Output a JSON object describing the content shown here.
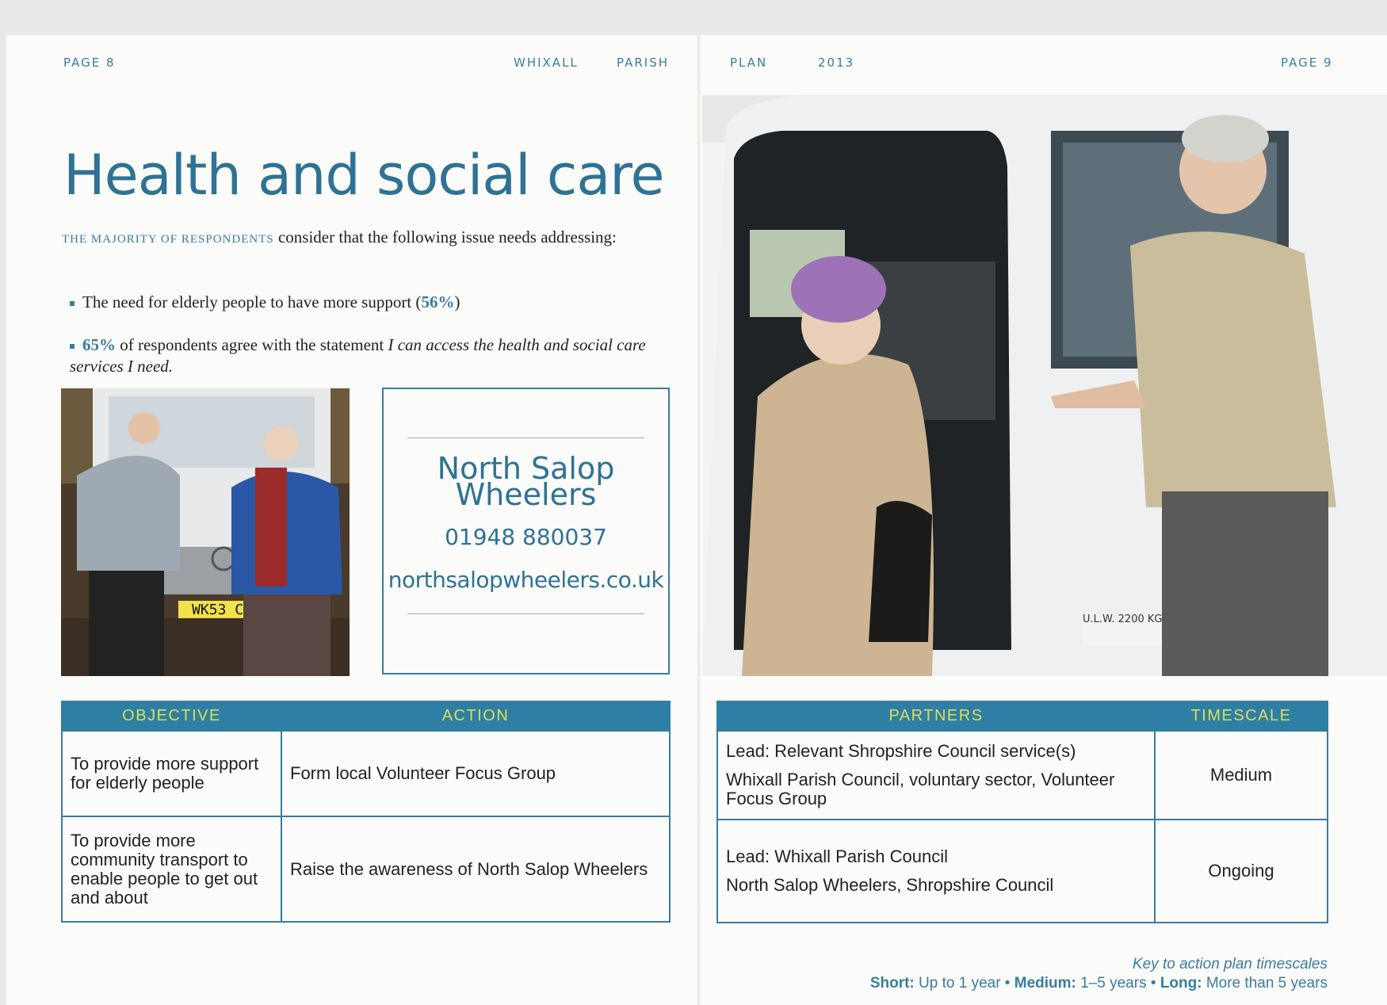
{
  "left_page": {
    "page_label": "PAGE 8",
    "running_head_1": "WHIXALL",
    "running_head_2": "PARISH",
    "title": "Health and social care",
    "intro_caps": "THE MAJORITY OF RESPONDENTS",
    "intro_rest": "consider that the following issue needs addressing:",
    "bullet1_text": "The need for elderly people to have more support (",
    "bullet1_pct": "56%",
    "bullet1_close": ")",
    "bullet2_pct": "65%",
    "bullet2_text": "of respondents agree with the statement",
    "bullet2_quote": "I can access the health and social care services I need."
  },
  "infobox": {
    "name_line1": "North Salop",
    "name_line2": "Wheelers",
    "phone": "01948 880037",
    "website": "northsalopwheelers.co.uk"
  },
  "left_photo": {
    "plate": "WK53 CS"
  },
  "right_photo": {
    "van_text": "U.L.W. 2200 KG"
  },
  "right_page": {
    "running_head_3": "PLAN",
    "running_head_4": "2013",
    "page_label": "PAGE 9"
  },
  "table_left": {
    "headers": [
      "OBJECTIVE",
      "ACTION"
    ],
    "rows": [
      {
        "objective": "To provide more support for elderly people",
        "action": "Form local Volunteer Focus Group"
      },
      {
        "objective": "To provide more community transport to enable people to get out and about",
        "action": "Raise the awareness of North Salop Wheelers"
      }
    ]
  },
  "table_right": {
    "headers": [
      "PARTNERS",
      "TIMESCALE"
    ],
    "rows": [
      {
        "lead": "Lead: Relevant Shropshire Council service(s)",
        "partners": "Whixall Parish Council, voluntary sector, Volunteer Focus Group",
        "timescale": "Medium"
      },
      {
        "lead": "Lead: Whixall Parish Council",
        "partners": "North Salop Wheelers, Shropshire Council",
        "timescale": "Ongoing"
      }
    ]
  },
  "key": {
    "heading": "Key to action plan timescales",
    "short_label": "Short:",
    "short_value": "Up to 1 year",
    "medium_label": "Medium:",
    "medium_value": "1–5 years",
    "long_label": "Long:",
    "long_value": "More than 5 years"
  },
  "colors": {
    "accent": "#2e7295",
    "table_header": "#2f7ea4",
    "header_text": "#d8e05a"
  }
}
